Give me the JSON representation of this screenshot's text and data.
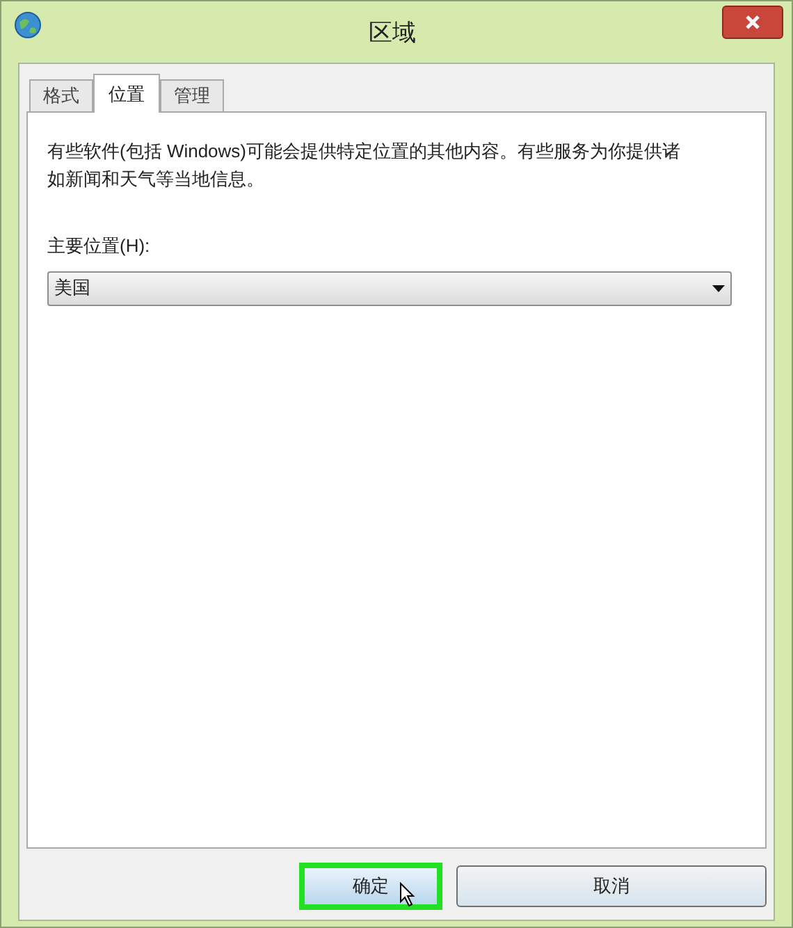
{
  "window": {
    "title": "区域"
  },
  "tabs": [
    {
      "label": "格式",
      "selected": false
    },
    {
      "label": "位置",
      "selected": true
    },
    {
      "label": "管理",
      "selected": false
    }
  ],
  "description": "有些软件(包括 Windows)可能会提供特定位置的其他内容。有些服务为你提供诸如新闻和天气等当地信息。",
  "home_location": {
    "label": "主要位置(H):",
    "value": "美国"
  },
  "buttons": [
    {
      "label": "确定",
      "highlighted": true
    },
    {
      "label": "取消",
      "highlighted": false
    }
  ]
}
